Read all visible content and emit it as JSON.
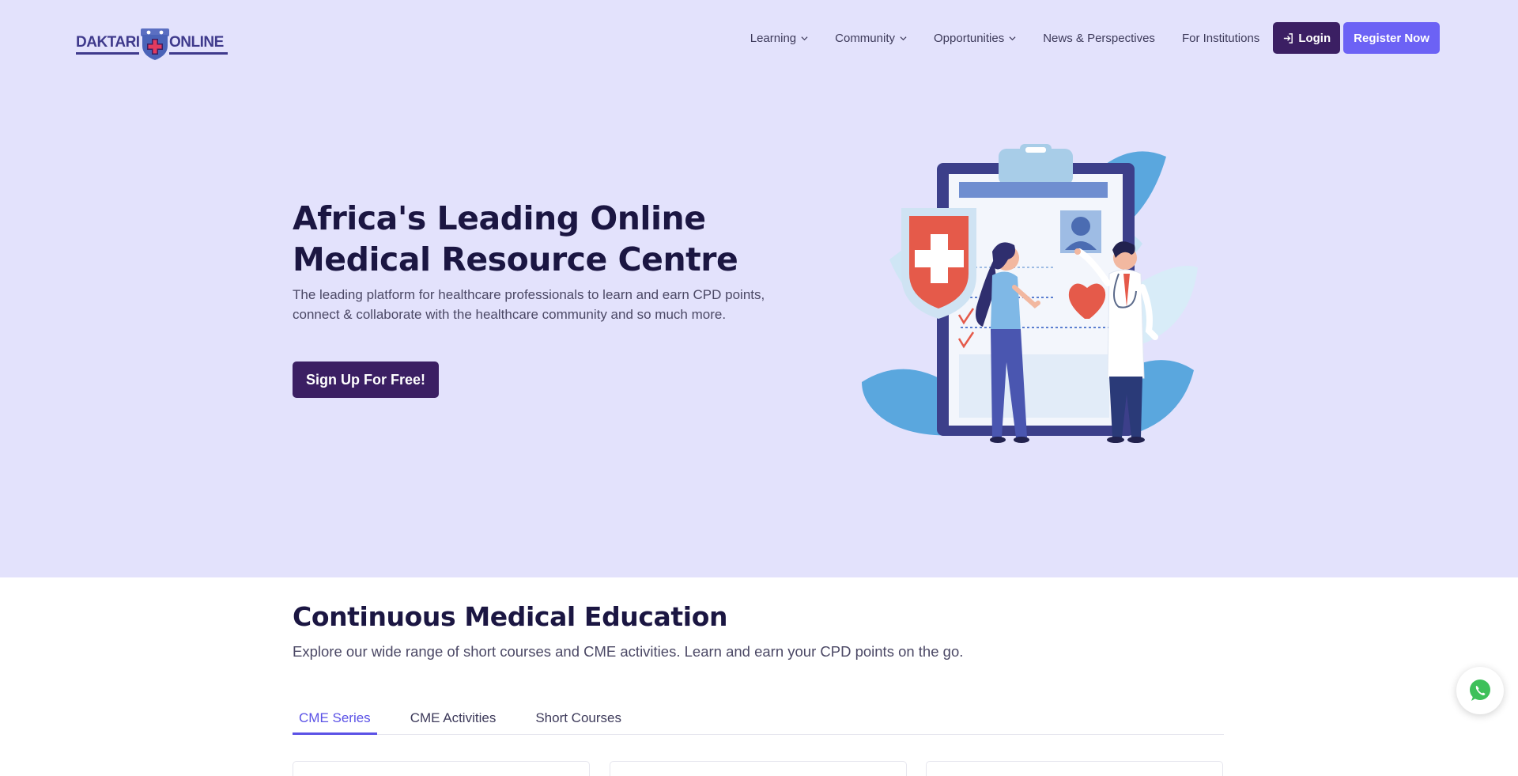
{
  "brand": {
    "logo_left": "DAKTARI",
    "logo_right": "ONLINE",
    "colors": {
      "navy": "#3f3a8c",
      "dark_purple": "#3b1f63",
      "accent": "#6c62f5",
      "hero_bg": "#e3e2fc"
    }
  },
  "nav": {
    "items": [
      {
        "label": "Learning",
        "has_dropdown": true
      },
      {
        "label": "Community",
        "has_dropdown": true
      },
      {
        "label": "Opportunities",
        "has_dropdown": true
      },
      {
        "label": "News & Perspectives",
        "has_dropdown": false
      },
      {
        "label": "For Institutions",
        "has_dropdown": false
      }
    ],
    "login_label": "Login",
    "register_label": "Register Now"
  },
  "hero": {
    "title": "Africa's Leading Online Medical Resource Centre",
    "subtitle": "The leading platform for healthcare professionals to learn and earn CPD points, connect & collaborate with the healthcare community and so much more.",
    "cta_label": "Sign Up For Free!"
  },
  "cme": {
    "title": "Continuous Medical Education",
    "subtitle": "Explore our wide range of short courses and CME activities. Learn and earn your CPD points on the go.",
    "tabs": [
      {
        "label": "CME Series",
        "active": true
      },
      {
        "label": "CME Activities",
        "active": false
      },
      {
        "label": "Short Courses",
        "active": false
      }
    ]
  },
  "floating": {
    "icon": "whatsapp-icon"
  }
}
